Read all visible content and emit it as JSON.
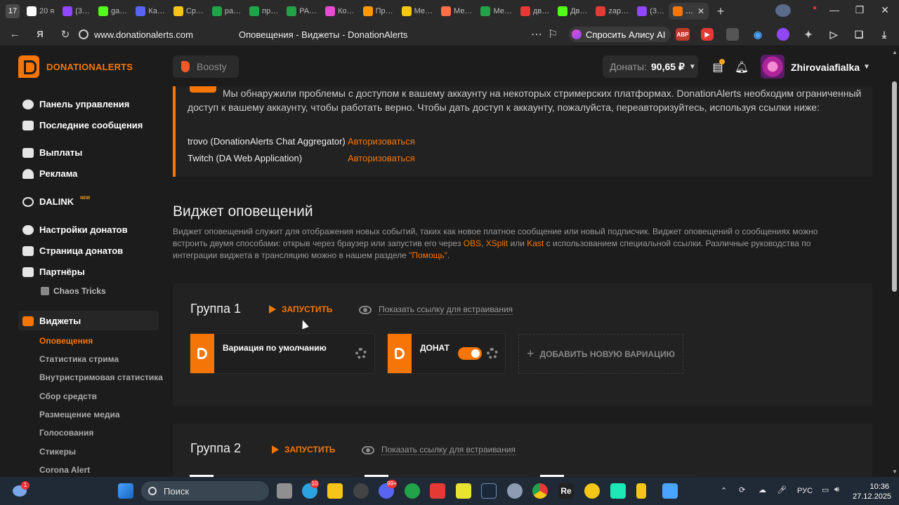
{
  "browser": {
    "tab_count": "17",
    "tabs": [
      {
        "label": "20 я",
        "color": "#ffffff"
      },
      {
        "label": "(3…",
        "color": "#9146ff"
      },
      {
        "label": "ga…",
        "color": "#53fc18"
      },
      {
        "label": "Ка…",
        "color": "#5865f2"
      },
      {
        "label": "Ср…",
        "color": "#f5c518"
      },
      {
        "label": "ра…",
        "color": "#22a34a"
      },
      {
        "label": "пр…",
        "color": "#22a34a"
      },
      {
        "label": "PA…",
        "color": "#22a34a"
      },
      {
        "label": "Ко…",
        "color": "#e84bd2"
      },
      {
        "label": "Пр…",
        "color": "#ff9900"
      },
      {
        "label": "Ме…",
        "color": "#f5c518"
      },
      {
        "label": "Ме…",
        "color": "#ff7043"
      },
      {
        "label": "Ме…",
        "color": "#22a34a"
      },
      {
        "label": "дв…",
        "color": "#e53935"
      },
      {
        "label": "Дв…",
        "color": "#53fc18"
      },
      {
        "label": "zap…",
        "color": "#e53935"
      },
      {
        "label": "(3…",
        "color": "#9146ff"
      },
      {
        "label": "…",
        "color": "#f57507"
      }
    ],
    "url": "www.donationalerts.com",
    "page_title": "Оповещения - Виджеты - DonationAlerts",
    "alice_label": "Спросить Алису AI",
    "abp_label": "ABP"
  },
  "header": {
    "logo_text": "DONATIONALERTS",
    "boosty_label": "Boosty",
    "donates_label": "Донаты:",
    "donates_value": "90,65 ₽",
    "username": "Zhirovaiafialka"
  },
  "sidebar": {
    "items": [
      {
        "label": "Панель управления"
      },
      {
        "label": "Последние сообщения"
      },
      {
        "label": "Выплаты"
      },
      {
        "label": "Реклама"
      },
      {
        "label": "DALINK",
        "badge": "NEW"
      },
      {
        "label": "Настройки донатов"
      },
      {
        "label": "Страница донатов"
      },
      {
        "label": "Партнёры"
      },
      {
        "label": "Виджеты"
      }
    ],
    "partner_sub": "Chaos Tricks",
    "widget_subs": [
      "Оповещения",
      "Статистика стрима",
      "Внутристримовая статистика",
      "Сбор средств",
      "Размещение медиа",
      "Голосования",
      "Стикеры",
      "Corona Alert"
    ]
  },
  "alert": {
    "text": "Мы обнаружили проблемы с доступом к вашему аккаунту на некоторых стримерских платформах. DonationAlerts необходим ограниченный доступ к вашему аккаунту, чтобы работать верно. Чтобы дать доступ к аккаунту, пожалуйста, переавторизуйтесь, используя ссылки ниже:",
    "rows": [
      {
        "platform": "trovo (DonationAlerts Chat Aggregator)",
        "action": "Авторизоваться"
      },
      {
        "platform": "Twitch (DA Web Application)",
        "action": "Авторизоваться"
      }
    ]
  },
  "widget": {
    "title": "Виджет оповещений",
    "desc_1": "Виджет оповещений служит для отображения новых событий, таких как новое платное сообщение или новый подписчик. Виджет оповещений о сообщениях можно встроить двумя способами: открыв через браузер или запустив его через ",
    "obs": "OBS",
    "comma": ", ",
    "xsplit": "XSplit",
    "or": " или ",
    "kast": "Kast",
    "desc_2": " с использованием специальной ссылки. Различные руководства по интеграции виджета в трансляцию можно в нашем разделе ",
    "help": "\"Помощь\"",
    "dot": "."
  },
  "groups": [
    {
      "title": "Группа 1",
      "launch": "ЗАПУСТИТЬ",
      "embed": "Показать ссылку для встраивания",
      "variations": [
        {
          "name": "Вариация по умолчанию"
        },
        {
          "name": "ДОНАТ",
          "enabled": true
        }
      ],
      "add_label": "ДОБАВИТЬ НОВУЮ ВАРИАЦИЮ"
    },
    {
      "title": "Группа 2",
      "launch": "ЗАПУСТИТЬ",
      "embed": "Показать ссылку для встраивания"
    }
  ],
  "taskbar": {
    "search_label": "Поиск",
    "badges": [
      "1",
      "10",
      "99+"
    ],
    "lang": "РУС",
    "time": "10:36",
    "date": "27.12.2025"
  }
}
